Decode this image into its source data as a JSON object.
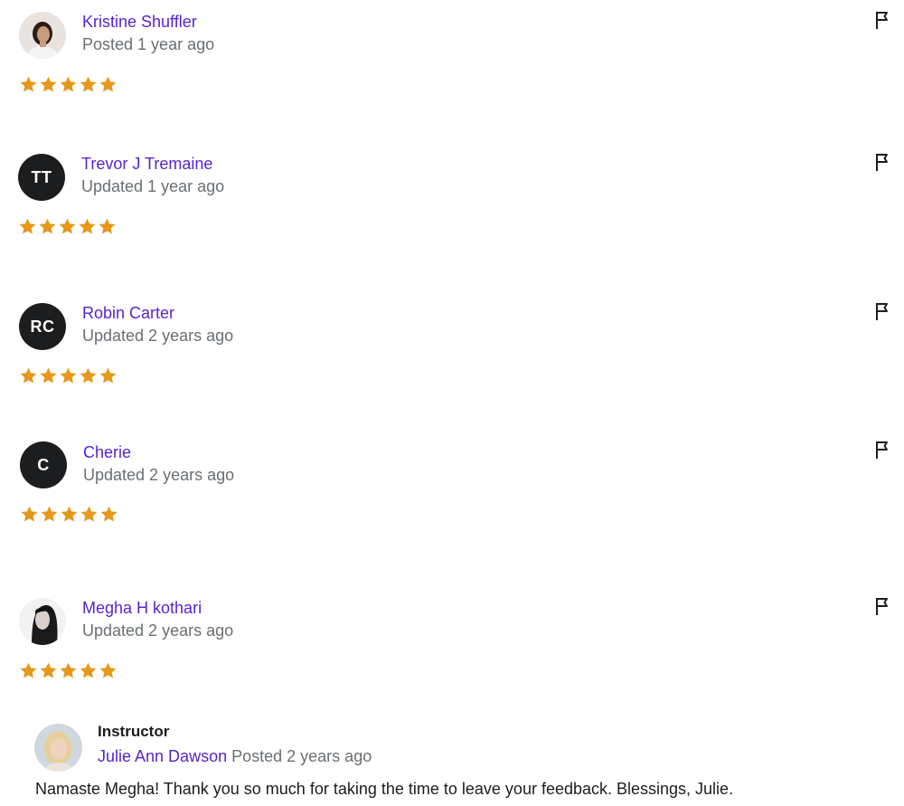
{
  "colors": {
    "accent": "#5624d0",
    "star": "#e59819",
    "muted": "#6a6f73",
    "text": "#1c1d1f"
  },
  "reviews": [
    {
      "name": "Kristine Shuffler",
      "date": "Posted 1 year ago",
      "rating": 5,
      "avatar": "photo"
    },
    {
      "name": "Trevor J Tremaine",
      "date": "Updated 1 year ago",
      "rating": 5,
      "avatar_initials": "TT"
    },
    {
      "name": "Robin Carter",
      "date": "Updated 2 years ago",
      "rating": 5,
      "avatar_initials": "RC"
    },
    {
      "name": "Cherie",
      "date": "Updated 2 years ago",
      "rating": 5,
      "avatar_initials": "C"
    },
    {
      "name": "Megha H kothari",
      "date": "Updated 2 years ago",
      "rating": 5,
      "avatar": "photo"
    }
  ],
  "instructor_response": {
    "title": "Instructor",
    "name": "Julie Ann Dawson",
    "date": "Posted 2 years ago",
    "text": "Namaste Megha! Thank you so much for taking the time to leave your feedback. Blessings, Julie."
  },
  "icons": {
    "report": "flag-icon",
    "rating": "star-icon"
  }
}
